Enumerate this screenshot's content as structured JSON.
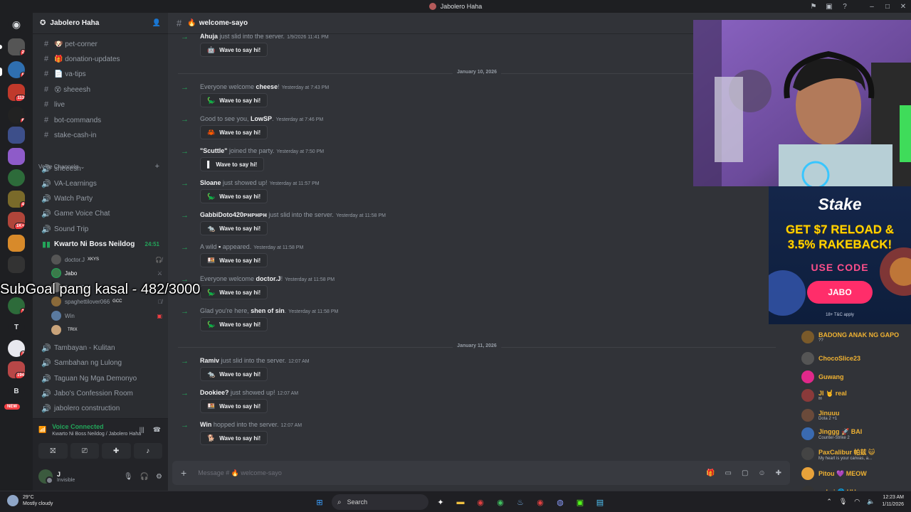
{
  "window": {
    "title": "Jabolero Haha"
  },
  "server": {
    "name": "Jabolero Haha"
  },
  "rail": {
    "badges": [
      "2",
      "5",
      "113",
      "6",
      "4",
      "1K+",
      "1",
      "7",
      "194"
    ],
    "letters": [
      "T",
      "B"
    ],
    "new_label": "NEW"
  },
  "channels": [
    {
      "name": "🐶 pet-corner"
    },
    {
      "name": "🎁 donation-updates"
    },
    {
      "name": "📄 va-tips"
    },
    {
      "name": "😵 sheeesh"
    },
    {
      "name": "live"
    },
    {
      "name": "bot-commands"
    },
    {
      "name": "stake-cash-in"
    }
  ],
  "voice_category": "Voice Channels",
  "voice_channels": [
    {
      "name": "sheeesh"
    },
    {
      "name": "VA-Learnings"
    },
    {
      "name": "Watch Party"
    },
    {
      "name": "Game Voice Chat"
    },
    {
      "name": "Sound Trip"
    },
    {
      "name": "Kwarto Ni Boss Neildog",
      "timer": "24:51"
    }
  ],
  "voice_users": [
    {
      "name": "doctor.J",
      "tag": "XKYS"
    },
    {
      "name": "Jabo"
    },
    {
      "name": "jhayy322"
    },
    {
      "name": "spaghettilover066",
      "tag": "GCC"
    },
    {
      "name": "Win"
    },
    {
      "name": "",
      "tag": "TRIX"
    }
  ],
  "voice_channels_lower": [
    {
      "name": "Tambayan - Kulitan"
    },
    {
      "name": "Sambahan ng Lulong"
    },
    {
      "name": "Taguan Ng Mga Demonyo"
    },
    {
      "name": "Jabo's Confession Room"
    },
    {
      "name": "jabolero construction"
    }
  ],
  "voice_panel": {
    "status": "Voice Connected",
    "location": "Kwarto Ni Boss Neildog / Jabolero Haha"
  },
  "user": {
    "name": "J",
    "status": "Invisible"
  },
  "chat": {
    "channel": "welcome-sayo",
    "wave_label": "Wave to say hi!",
    "composer_placeholder": "Message # 🔥 welcome-sayo"
  },
  "dividers": [
    "January 10, 2026",
    "January 11, 2026"
  ],
  "messages": [
    {
      "pre": "",
      "name": "Ahuja",
      "post": " just slid into the server.",
      "time": "1/9/2026 11:41 PM",
      "icon": "🤖"
    },
    {
      "pre": "Everyone welcome ",
      "name": "cheese",
      "post": "!",
      "time": "Yesterday at 7:43 PM",
      "icon": "🦕"
    },
    {
      "pre": "Good to see you, ",
      "name": "LowSP",
      "post": ".",
      "time": "Yesterday at 7:46 PM",
      "icon": "🦀"
    },
    {
      "pre": "",
      "name": "\"Scuttle\"",
      "post": " joined the party.",
      "time": "Yesterday at 7:50 PM",
      "icon": "▌"
    },
    {
      "pre": "",
      "name": "Sloane",
      "post": " just showed up!",
      "time": "Yesterday at 11:57 PM",
      "icon": "🦕"
    },
    {
      "pre": "",
      "name": "GabbiDoto420ᴘʜᴘʜᴘʜ",
      "post": " just slid into the server.",
      "time": "Yesterday at 11:58 PM",
      "icon": "🐀"
    },
    {
      "pre": "A wild ",
      "name": "▪",
      "post": " appeared.",
      "time": "Yesterday at 11:58 PM",
      "icon": "🍱"
    },
    {
      "pre": "Everyone welcome ",
      "name": "doctor.J",
      "post": "!",
      "time": "Yesterday at 11:58 PM",
      "icon": "🦕"
    },
    {
      "pre": "Glad you're here, ",
      "name": "shen of sin",
      "post": ".",
      "time": "Yesterday at 11:58 PM",
      "icon": "🦕"
    },
    {
      "pre": "",
      "name": "Ramiv",
      "post": " just slid into the server.",
      "time": "12:07 AM",
      "icon": "🐀"
    },
    {
      "pre": "",
      "name": "Dookiee?",
      "post": " just showed up!",
      "time": "12:07 AM",
      "icon": "🍱"
    },
    {
      "pre": "",
      "name": "Win",
      "post": " hopped into the server.",
      "time": "12:07 AM",
      "icon": "🐕"
    }
  ],
  "overlay": {
    "subgoal": "SubGoal pang kasal - 482/3000",
    "stake_logo": "Stake",
    "stake_promo_1": "GET $7 RELOAD &",
    "stake_promo_2": "3.5% RAKEBACK!",
    "stake_use_code": "USE CODE",
    "stake_code": "JABO",
    "stake_tnc": "18+ T&C apply"
  },
  "viewers": [
    {
      "name": "BADONG ANAK NG GAPO",
      "sub": "??"
    },
    {
      "name": "ChocoSlice23",
      "sub": ""
    },
    {
      "name": "Guwang",
      "sub": ""
    },
    {
      "name": "JI 🤘 real",
      "sub": "ᴮᴮ"
    },
    {
      "name": "Jinuuu",
      "sub": "Dota 2 +1"
    },
    {
      "name": "Jinggg 🚀 BAI",
      "sub": "Counter-Strike 2"
    },
    {
      "name": "PaxCalibur 帕兹 😺",
      "sub": "My heart is your canvas, a..."
    },
    {
      "name": "Pitou 💜 MEOW",
      "sub": ""
    },
    {
      "name": "pslmi 🌐 HU",
      "sub": ""
    }
  ],
  "taskbar": {
    "temp": "29°C",
    "weather": "Mostly cloudy",
    "search": "Search",
    "time": "12:23 AM",
    "date": "1/11/2026"
  },
  "colors": {
    "accent": "#23a55a",
    "chat_bg": "#313338",
    "sidebar_bg": "#2b2d31",
    "rail_bg": "#1e1f22"
  }
}
